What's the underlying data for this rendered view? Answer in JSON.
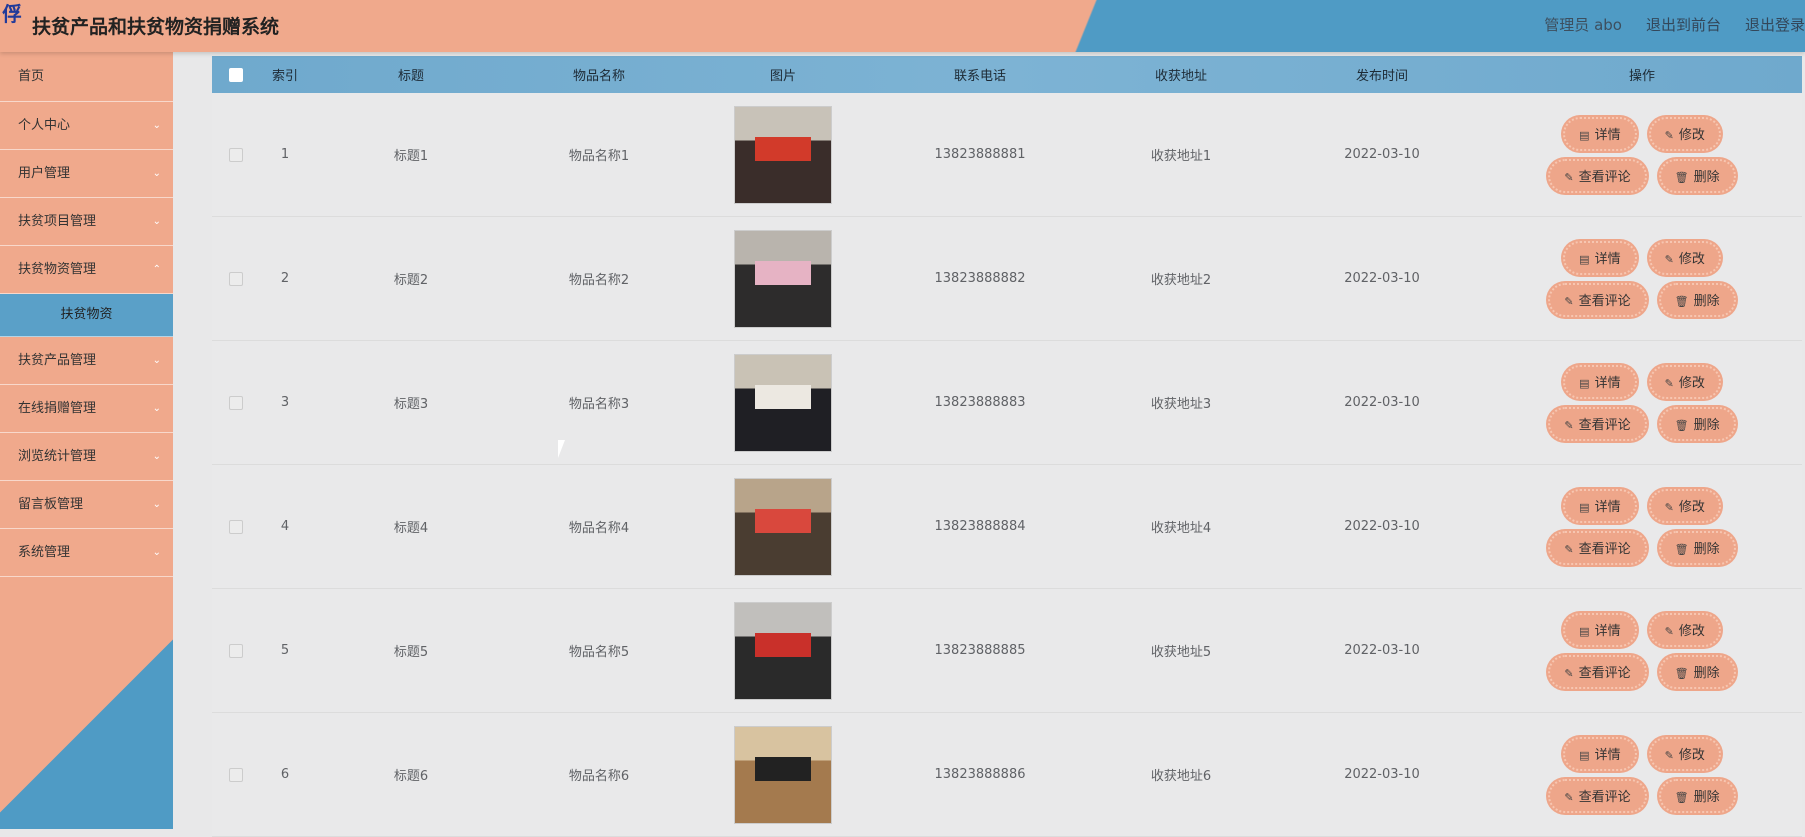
{
  "header": {
    "logo_glyph": "俘",
    "title": "扶贫产品和扶贫物资捐赠系统",
    "admin": "管理员 abo",
    "front": "退出到前台",
    "logout": "退出登录"
  },
  "sidebar": {
    "items": [
      {
        "label": "首页"
      },
      {
        "label": "个人中心"
      },
      {
        "label": "用户管理"
      },
      {
        "label": "扶贫项目管理"
      },
      {
        "label": "扶贫物资管理"
      },
      {
        "label": "扶贫物资"
      },
      {
        "label": "扶贫产品管理"
      },
      {
        "label": "在线捐赠管理"
      },
      {
        "label": "浏览统计管理"
      },
      {
        "label": "留言板管理"
      },
      {
        "label": "系统管理"
      }
    ]
  },
  "table": {
    "headers": [
      "索引",
      "标题",
      "物品名称",
      "图片",
      "联系电话",
      "收获地址",
      "发布时间",
      "操作"
    ],
    "buttons": {
      "detail": "详情",
      "edit": "修改",
      "comment": "查看评论",
      "delete": "删除"
    },
    "rows": [
      {
        "idx": "1",
        "title": "标题1",
        "name": "物品名称1",
        "phone": "13823888881",
        "addr": "收获地址1",
        "time": "2022-03-10"
      },
      {
        "idx": "2",
        "title": "标题2",
        "name": "物品名称2",
        "phone": "13823888882",
        "addr": "收获地址2",
        "time": "2022-03-10"
      },
      {
        "idx": "3",
        "title": "标题3",
        "name": "物品名称3",
        "phone": "13823888883",
        "addr": "收获地址3",
        "time": "2022-03-10"
      },
      {
        "idx": "4",
        "title": "标题4",
        "name": "物品名称4",
        "phone": "13823888884",
        "addr": "收获地址4",
        "time": "2022-03-10"
      },
      {
        "idx": "5",
        "title": "标题5",
        "name": "物品名称5",
        "phone": "13823888885",
        "addr": "收获地址5",
        "time": "2022-03-10"
      },
      {
        "idx": "6",
        "title": "标题6",
        "name": "物品名称6",
        "phone": "13823888886",
        "addr": "收获地址6",
        "time": "2022-03-10"
      }
    ]
  },
  "colors": {
    "salmon": "#f0a98c",
    "blue": "#4f9bc5",
    "button": "#eea68a"
  }
}
